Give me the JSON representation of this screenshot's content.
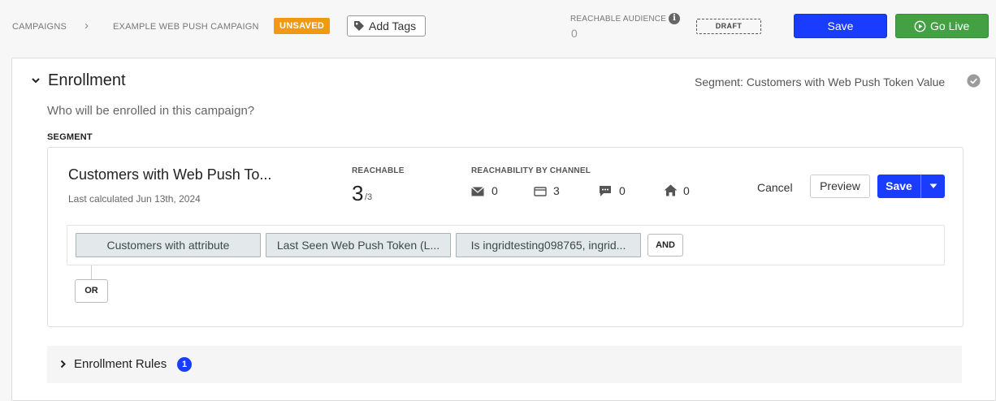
{
  "breadcrumb": {
    "items": [
      "CAMPAIGNS",
      "EXAMPLE WEB PUSH CAMPAIGN"
    ],
    "separator": "›"
  },
  "status_badge": "UNSAVED",
  "add_tags_label": "Add Tags",
  "reachable_audience": {
    "label": "REACHABLE AUDIENCE",
    "value": "0"
  },
  "draft_badge": "DRAFT",
  "header_actions": {
    "save_label": "Save",
    "go_live_label": "Go Live"
  },
  "enrollment": {
    "title": "Enrollment",
    "segment_summary": "Segment: Customers with Web Push Token Value",
    "question": "Who will be enrolled in this campaign?",
    "segment_label": "SEGMENT"
  },
  "segment_card": {
    "name": "Customers with Web Push Token Value",
    "last_calculated": "Last calculated Jun 13th, 2024",
    "reachable_label": "REACHABLE",
    "reachable_value": "3",
    "reachable_total": "/3",
    "channel_label": "REACHABILITY BY CHANNEL",
    "channels": [
      {
        "icon": "email-icon",
        "value": "0"
      },
      {
        "icon": "browser-icon",
        "value": "3"
      },
      {
        "icon": "sms-icon",
        "value": "0"
      },
      {
        "icon": "home-icon",
        "value": "0"
      }
    ],
    "cancel_label": "Cancel",
    "preview_label": "Preview",
    "save_label": "Save"
  },
  "rule": {
    "chips": [
      "Customers with attribute",
      "Last Seen Web Push Token (L...",
      "Is ingridtesting098765, ingrid..."
    ],
    "and_label": "AND",
    "or_label": "OR"
  },
  "enrollment_rules": {
    "title": "Enrollment Rules",
    "count": "1"
  },
  "colors": {
    "primary": "#1a3cff",
    "success": "#44a143",
    "warning": "#f19a11",
    "chip_bg": "#e3e9ea"
  }
}
